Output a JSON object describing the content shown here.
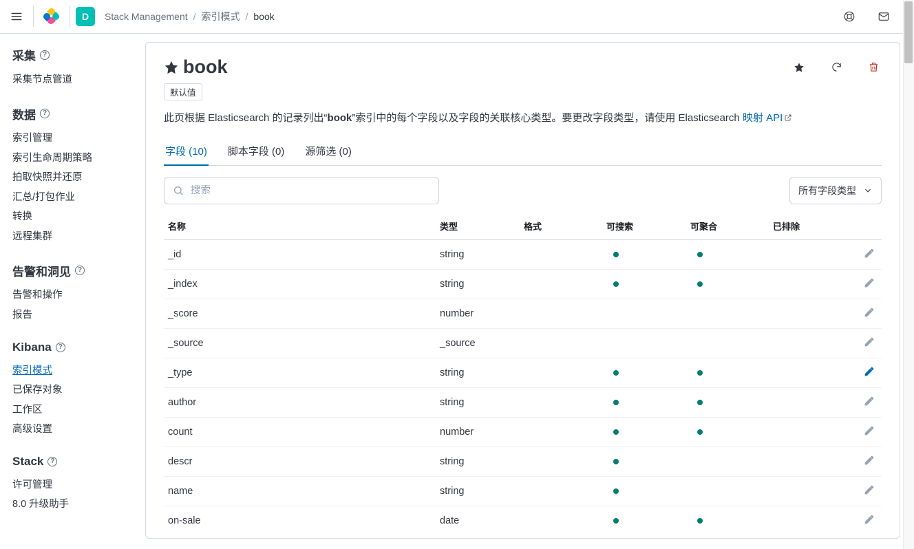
{
  "header": {
    "space_letter": "D",
    "breadcrumbs": [
      "Stack Management",
      "索引模式",
      "book"
    ]
  },
  "sidebar": {
    "sections": [
      {
        "title": "采集",
        "items": [
          "采集节点管道"
        ]
      },
      {
        "title": "数据",
        "items": [
          "索引管理",
          "索引生命周期策略",
          "拍取快照并还原",
          "汇总/打包作业",
          "转换",
          "远程集群"
        ]
      },
      {
        "title": "告警和洞见",
        "items": [
          "告警和操作",
          "报告"
        ]
      },
      {
        "title": "Kibana",
        "items": [
          "索引模式",
          "已保存对象",
          "工作区",
          "高级设置"
        ]
      },
      {
        "title": "Stack",
        "items": [
          "许可管理",
          "8.0 升级助手"
        ]
      }
    ],
    "active_item": "索引模式"
  },
  "pattern": {
    "name": "book",
    "default_badge": "默认值",
    "description_pre": "此页根据 Elasticsearch 的记录列出“",
    "description_strong": "book",
    "description_post": "”索引中的每个字段以及字段的关联核心类型。要更改字段类型，请使用 Elasticsearch ",
    "mapping_link": "映射 API"
  },
  "tabs": [
    {
      "label": "字段 (10)",
      "active": true
    },
    {
      "label": "脚本字段 (0)",
      "active": false
    },
    {
      "label": "源筛选 (0)",
      "active": false
    }
  ],
  "filters": {
    "search_placeholder": "搜索",
    "type_filter_label": "所有字段类型"
  },
  "table": {
    "columns": [
      "名称",
      "类型",
      "格式",
      "可搜索",
      "可聚合",
      "已排除",
      ""
    ],
    "rows": [
      {
        "name": "_id",
        "type": "string",
        "format": "",
        "searchable": true,
        "aggregatable": true,
        "excluded": false,
        "edit_active": false
      },
      {
        "name": "_index",
        "type": "string",
        "format": "",
        "searchable": true,
        "aggregatable": true,
        "excluded": false,
        "edit_active": false
      },
      {
        "name": "_score",
        "type": "number",
        "format": "",
        "searchable": false,
        "aggregatable": false,
        "excluded": false,
        "edit_active": false
      },
      {
        "name": "_source",
        "type": "_source",
        "format": "",
        "searchable": false,
        "aggregatable": false,
        "excluded": false,
        "edit_active": false
      },
      {
        "name": "_type",
        "type": "string",
        "format": "",
        "searchable": true,
        "aggregatable": true,
        "excluded": false,
        "edit_active": true
      },
      {
        "name": "author",
        "type": "string",
        "format": "",
        "searchable": true,
        "aggregatable": true,
        "excluded": false,
        "edit_active": false
      },
      {
        "name": "count",
        "type": "number",
        "format": "",
        "searchable": true,
        "aggregatable": true,
        "excluded": false,
        "edit_active": false
      },
      {
        "name": "descr",
        "type": "string",
        "format": "",
        "searchable": true,
        "aggregatable": false,
        "excluded": false,
        "edit_active": false
      },
      {
        "name": "name",
        "type": "string",
        "format": "",
        "searchable": true,
        "aggregatable": false,
        "excluded": false,
        "edit_active": false
      },
      {
        "name": "on-sale",
        "type": "date",
        "format": "",
        "searchable": true,
        "aggregatable": true,
        "excluded": false,
        "edit_active": false
      }
    ]
  }
}
